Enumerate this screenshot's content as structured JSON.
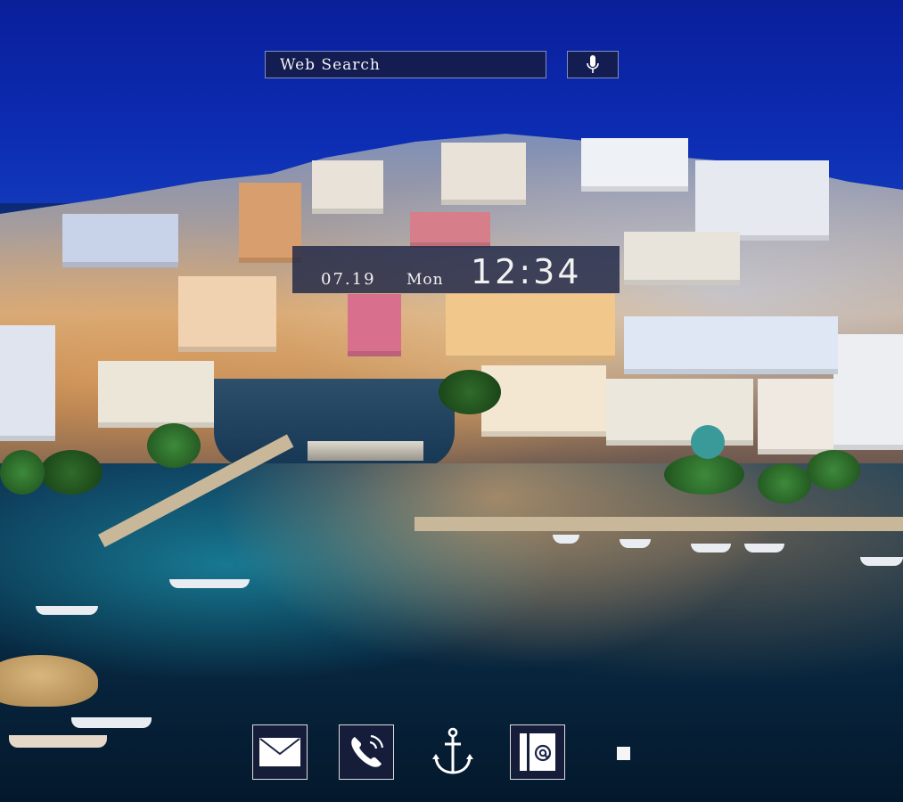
{
  "search": {
    "placeholder": "Web Search",
    "mic_icon": "microphone-icon"
  },
  "clock": {
    "date": "07.19",
    "day": "Mon",
    "time": "12:34"
  },
  "dock": {
    "items": [
      {
        "id": "mail",
        "icon": "envelope-icon"
      },
      {
        "id": "phone",
        "icon": "phone-icon"
      },
      {
        "id": "home",
        "icon": "anchor-icon"
      },
      {
        "id": "contacts",
        "icon": "contacts-icon"
      },
      {
        "id": "drawer",
        "icon": "square-icon"
      }
    ]
  },
  "colors": {
    "sky": "#0c2cb2",
    "widget_bg": "#1c2446",
    "icon": "#ffffff"
  }
}
